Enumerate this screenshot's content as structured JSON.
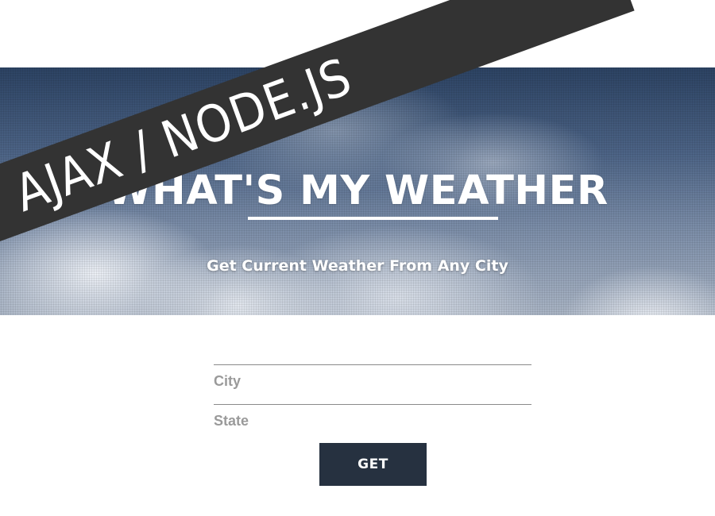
{
  "banner": {
    "text": "AJAX / NODE.JS",
    "background": "#333333"
  },
  "hero": {
    "title": "WHAT'S MY WEATHER",
    "subtitle": "Get Current Weather From Any City"
  },
  "form": {
    "city": {
      "placeholder": "City",
      "value": ""
    },
    "state": {
      "placeholder": "State",
      "value": ""
    },
    "submit_label": "GET",
    "button_color": "#263140"
  }
}
